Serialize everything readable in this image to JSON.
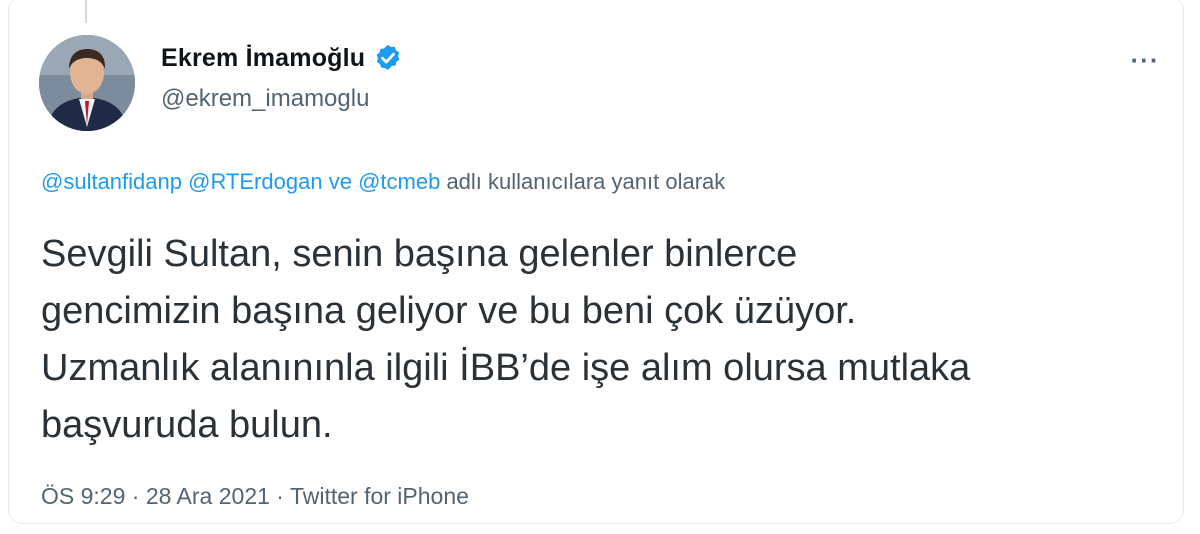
{
  "tweet": {
    "author": {
      "display_name": "Ekrem İmamoğlu",
      "handle": "@ekrem_imamoglu",
      "verified": true,
      "avatar_icon": "profile-photo"
    },
    "more_icon": "more-horizontal-icon",
    "more_label": "···",
    "reply_context": {
      "mention_1": "@sultanfidanp",
      "mention_2": "@RTErdogan",
      "connector": "ve",
      "mention_3": "@tcmeb",
      "suffix": "adlı kullanıcılara yanıt olarak"
    },
    "text_lines": [
      "Sevgili Sultan, senin başına gelenler binlerce",
      "gencimizin başına geliyor ve bu beni çok üzüyor.",
      "Uzmanlık alanınınla ilgili İBB’de işe alım olursa mutlaka",
      "başvuruda bulun."
    ],
    "meta": {
      "time": "ÖS 9:29",
      "date": "28 Ara 2021",
      "source": "Twitter for iPhone",
      "separator": "·"
    }
  },
  "colors": {
    "accent": "#1d9bf0",
    "secondary_text": "#536471",
    "border": "#e7ebee"
  }
}
